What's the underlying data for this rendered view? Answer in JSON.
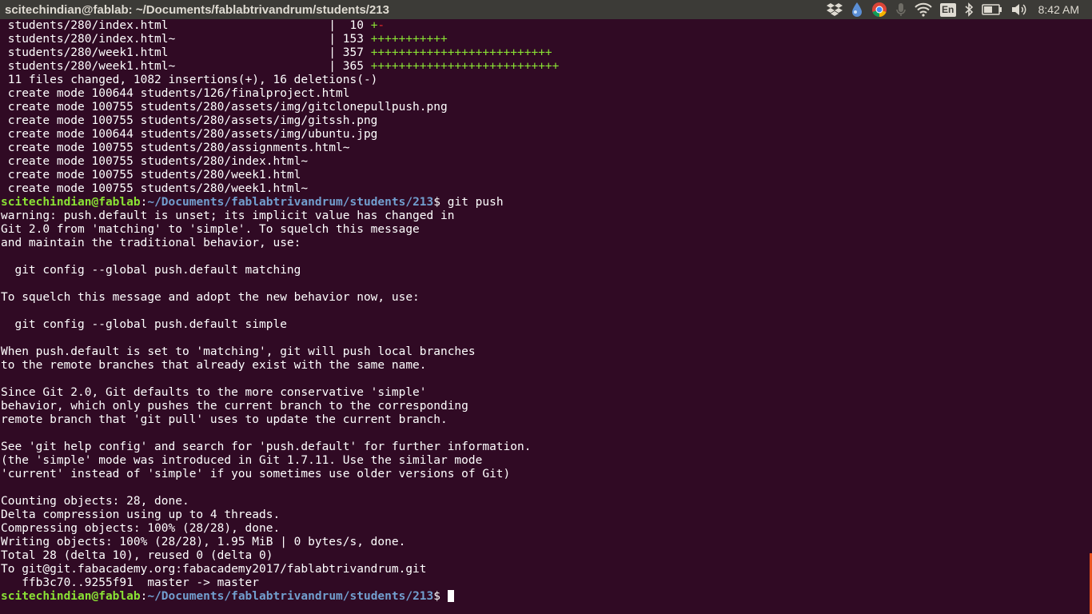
{
  "window": {
    "title": "scitechindian@fablab: ~/Documents/fablabtrivandrum/students/213"
  },
  "tray": {
    "language": "En",
    "clock": "8:42 AM",
    "icons": [
      "dropbox-icon",
      "drop-icon",
      "chrome-icon",
      "microphone-icon",
      "wifi-icon",
      "keyboard-language-icon",
      "bluetooth-icon",
      "battery-icon",
      "volume-icon"
    ]
  },
  "colors": {
    "terminal_bg": "#300a24",
    "prompt_user": "#8ae234",
    "prompt_path": "#729fcf",
    "diff_plus": "#8ae234",
    "diff_minus": "#ef2929"
  },
  "terminal": {
    "prompt_user": "scitechindian@fablab",
    "prompt_sep": ":",
    "prompt_path": "~/Documents/fablabtrivandrum/students/213",
    "prompt_symbol": "$ ",
    "stat_lines": [
      {
        "file": " students/280/index.html                       |  10 ",
        "plus": "+",
        "minus": "-"
      },
      {
        "file": " students/280/index.html~                      | 153 ",
        "plus": "+++++++++++",
        "minus": ""
      },
      {
        "file": " students/280/week1.html                       | 357 ",
        "plus": "++++++++++++++++++++++++++",
        "minus": ""
      },
      {
        "file": " students/280/week1.html~                      | 365 ",
        "plus": "+++++++++++++++++++++++++++",
        "minus": ""
      }
    ],
    "commit_summary": [
      " 11 files changed, 1082 insertions(+), 16 deletions(-)",
      " create mode 100644 students/126/finalproject.html",
      " create mode 100755 students/280/assets/img/gitclonepullpush.png",
      " create mode 100755 students/280/assets/img/gitssh.png",
      " create mode 100644 students/280/assets/img/ubuntu.jpg",
      " create mode 100755 students/280/assignments.html~",
      " create mode 100755 students/280/index.html~",
      " create mode 100755 students/280/week1.html",
      " create mode 100755 students/280/week1.html~"
    ],
    "command": "git push",
    "output": [
      "warning: push.default is unset; its implicit value has changed in",
      "Git 2.0 from 'matching' to 'simple'. To squelch this message",
      "and maintain the traditional behavior, use:",
      "",
      "  git config --global push.default matching",
      "",
      "To squelch this message and adopt the new behavior now, use:",
      "",
      "  git config --global push.default simple",
      "",
      "When push.default is set to 'matching', git will push local branches",
      "to the remote branches that already exist with the same name.",
      "",
      "Since Git 2.0, Git defaults to the more conservative 'simple'",
      "behavior, which only pushes the current branch to the corresponding",
      "remote branch that 'git pull' uses to update the current branch.",
      "",
      "See 'git help config' and search for 'push.default' for further information.",
      "(the 'simple' mode was introduced in Git 1.7.11. Use the similar mode",
      "'current' instead of 'simple' if you sometimes use older versions of Git)",
      "",
      "Counting objects: 28, done.",
      "Delta compression using up to 4 threads.",
      "Compressing objects: 100% (28/28), done.",
      "Writing objects: 100% (28/28), 1.95 MiB | 0 bytes/s, done.",
      "Total 28 (delta 10), reused 0 (delta 0)",
      "To git@git.fabacademy.org:fabacademy2017/fablabtrivandrum.git",
      "   ffb3c70..9255f91  master -> master"
    ]
  }
}
